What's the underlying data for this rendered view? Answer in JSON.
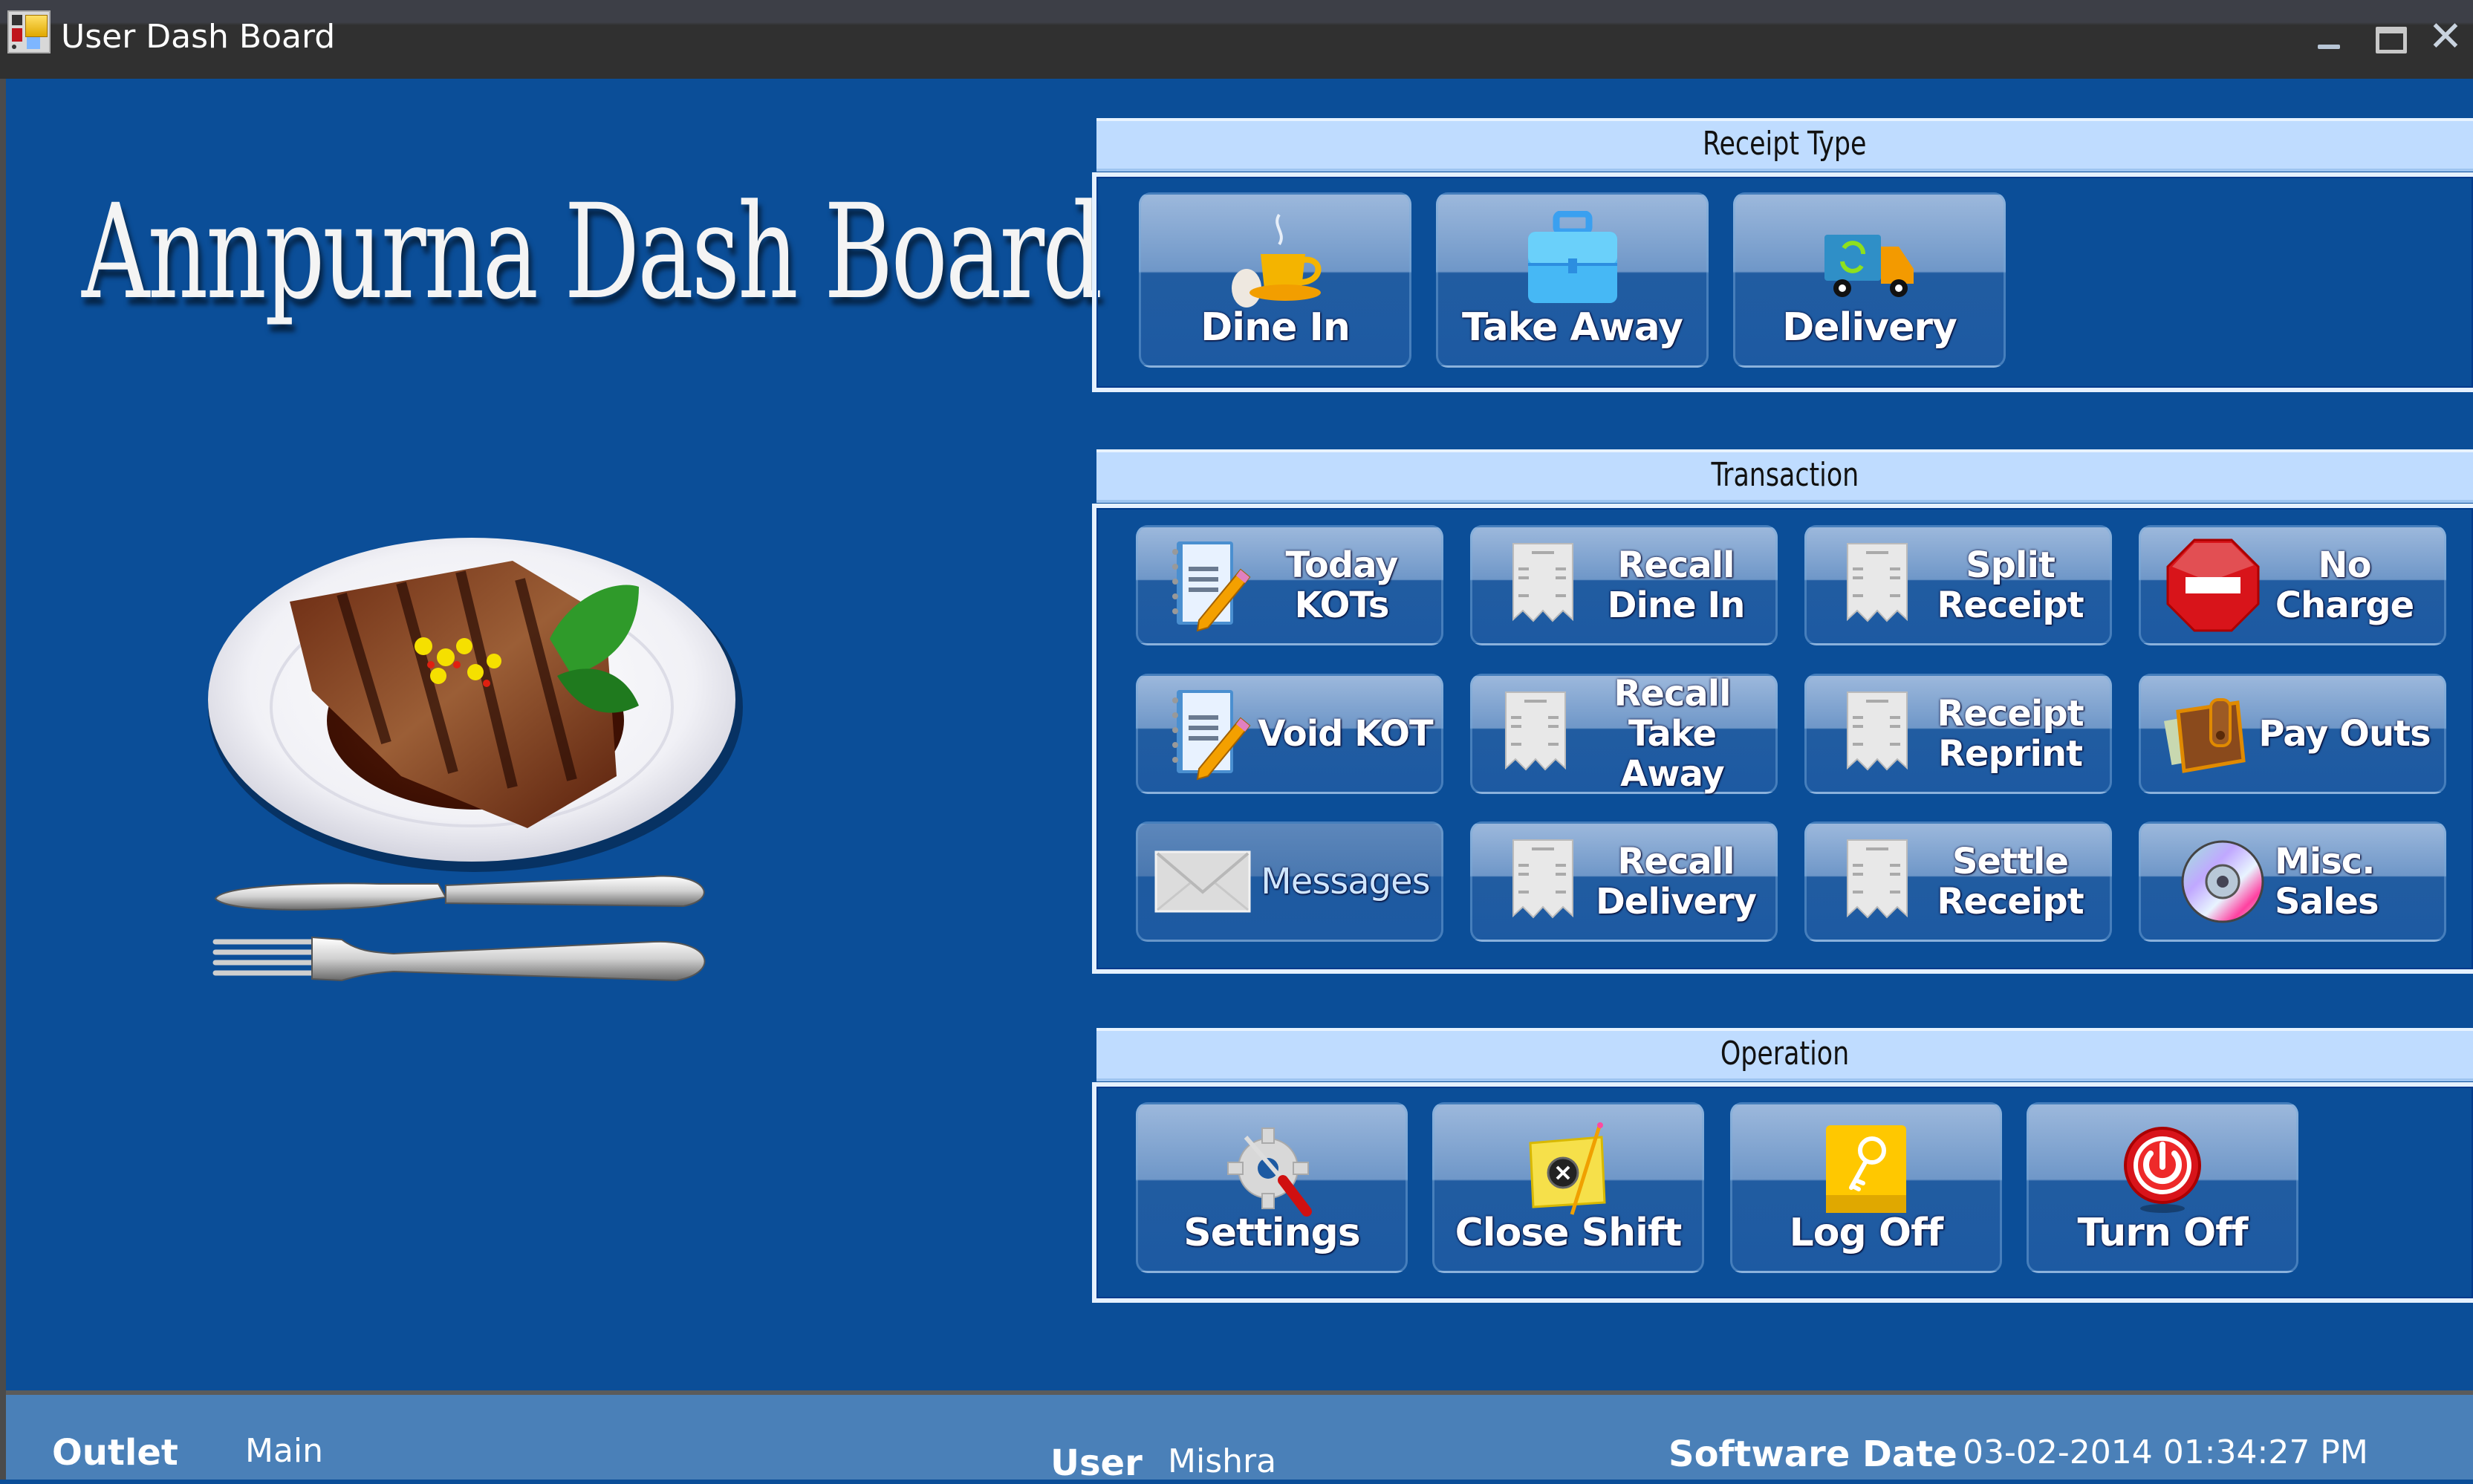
{
  "window": {
    "title": "User Dash Board",
    "app_icon": "dashboard-app-icon",
    "controls": {
      "minimize": "minimize-icon",
      "maximize": "maximize-icon",
      "close": "✕"
    }
  },
  "brand": {
    "title": "Annpurna Dash Board",
    "illustration": "steak-plate-with-knife-and-fork"
  },
  "sections": {
    "receipt_type": {
      "title": "Receipt Type",
      "buttons": [
        {
          "label": "Dine In",
          "icon": "coffee-cup-icon"
        },
        {
          "label": "Take Away",
          "icon": "briefcase-icon"
        },
        {
          "label": "Delivery",
          "icon": "delivery-truck-icon"
        }
      ]
    },
    "transaction": {
      "title": "Transaction",
      "buttons": [
        {
          "label": "Today\nKOTs",
          "icon": "notebook-pencil-icon",
          "enabled": true
        },
        {
          "label": "Recall\nDine In",
          "icon": "receipt-icon",
          "enabled": true
        },
        {
          "label": "Split\nReceipt",
          "icon": "receipt-icon",
          "enabled": true
        },
        {
          "label": "No\nCharge",
          "icon": "stop-sign-icon",
          "enabled": true
        },
        {
          "label": "Void KOT",
          "icon": "notebook-pencil-icon",
          "enabled": true
        },
        {
          "label": "Recall\nTake Away",
          "icon": "receipt-icon",
          "enabled": true
        },
        {
          "label": "Receipt\nReprint",
          "icon": "receipt-icon",
          "enabled": true
        },
        {
          "label": "Pay Outs",
          "icon": "wallet-icon",
          "enabled": true
        },
        {
          "label": "Messages",
          "icon": "envelope-icon",
          "enabled": false
        },
        {
          "label": "Recall\nDelivery",
          "icon": "receipt-icon",
          "enabled": true
        },
        {
          "label": "Settle\nReceipt",
          "icon": "receipt-icon",
          "enabled": true
        },
        {
          "label": "Misc.\nSales",
          "icon": "cd-disc-icon",
          "enabled": true
        }
      ]
    },
    "operation": {
      "title": "Operation",
      "buttons": [
        {
          "label": "Settings",
          "icon": "gear-screwdriver-icon"
        },
        {
          "label": "Close Shift",
          "icon": "close-shift-note-icon"
        },
        {
          "label": "Log Off",
          "icon": "key-icon"
        },
        {
          "label": "Turn Off",
          "icon": "power-icon"
        }
      ]
    }
  },
  "status_bar": {
    "outlet_label": "Outlet",
    "outlet_value": "Main",
    "user_label": "User",
    "user_value": "Mishra",
    "date_label": "Software Date",
    "date_value": "03-02-2014 01:34:27 PM"
  },
  "colors": {
    "background": "#0b4e98",
    "header": "#bfdcff",
    "status_bar": "#4a80b8",
    "titlebar": "#303030"
  }
}
